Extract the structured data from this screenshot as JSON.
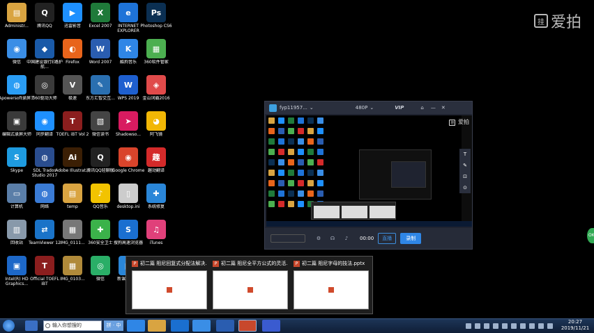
{
  "desktop": {
    "icons": [
      {
        "label": "Administr...",
        "glyph": "▤",
        "color": "#d9a441"
      },
      {
        "label": "腾讯QQ",
        "glyph": "Q",
        "color": "#222222"
      },
      {
        "label": "迅雷影音",
        "glyph": "▶",
        "color": "#1e90ff"
      },
      {
        "label": "Excel 2007",
        "glyph": "X",
        "color": "#1f7a3a"
      },
      {
        "label": "INTERNET EXPLORER",
        "glyph": "e",
        "color": "#1e73d8"
      },
      {
        "label": "Photoshop CS6",
        "glyph": "Ps",
        "color": "#0b2f52"
      },
      {
        "label": "微信",
        "glyph": "◉",
        "color": "#3a8ee6"
      },
      {
        "label": "中国建设银行E路护航...",
        "glyph": "◆",
        "color": "#1a5aa8"
      },
      {
        "label": "Firefox",
        "glyph": "◐",
        "color": "#e8641b"
      },
      {
        "label": "Word 2007",
        "glyph": "W",
        "color": "#2a5db0"
      },
      {
        "label": "酷狗音乐",
        "glyph": "K",
        "color": "#2f86e6"
      },
      {
        "label": "360软件管家",
        "glyph": "▦",
        "color": "#4caf50"
      },
      {
        "label": "Apowersoft录屏王",
        "glyph": "◍",
        "color": "#2a9df4"
      },
      {
        "label": "360驱动大师",
        "glyph": "◎",
        "color": "#3a3a3a"
      },
      {
        "label": "极速",
        "glyph": "V",
        "color": "#555555"
      },
      {
        "label": "东方汇智交互...",
        "glyph": "✎",
        "color": "#2a6fb0"
      },
      {
        "label": "WPS 2019",
        "glyph": "W",
        "color": "#1e5fcf"
      },
      {
        "label": "金山词霸2016",
        "glyph": "◈",
        "color": "#e04a4a"
      },
      {
        "label": "编辑式录屏大师",
        "glyph": "▣",
        "color": "#3a3a3a"
      },
      {
        "label": "同步翻译",
        "glyph": "◉",
        "color": "#1e90ff"
      },
      {
        "label": "TOEFL iBT Vol 2",
        "glyph": "T",
        "color": "#8b1e1e"
      },
      {
        "label": "微信读书",
        "glyph": "▧",
        "color": "#444444"
      },
      {
        "label": "Shadowso...",
        "glyph": "➤",
        "color": "#d81b60"
      },
      {
        "label": "阿飞镜",
        "glyph": "◕",
        "color": "#f2b705"
      },
      {
        "label": "Skype",
        "glyph": "S",
        "color": "#1e9be0"
      },
      {
        "label": "SDL Trados Studio 2017",
        "glyph": "◍",
        "color": "#2a4d8f"
      },
      {
        "label": "Adobe Illustrat...",
        "glyph": "Ai",
        "color": "#3b1f05"
      },
      {
        "label": "腾讯QQ轻聊版",
        "glyph": "Q",
        "color": "#222222"
      },
      {
        "label": "Google Chrome",
        "glyph": "◉",
        "color": "#d9442b"
      },
      {
        "label": "趣动翻译",
        "glyph": "趣",
        "color": "#d42a2a"
      },
      {
        "label": "计算机",
        "glyph": "▭",
        "color": "#5a7ea8"
      },
      {
        "label": "网络",
        "glyph": "◍",
        "color": "#3a7bd5"
      },
      {
        "label": "temp",
        "glyph": "▤",
        "color": "#d9a441"
      },
      {
        "label": "QQ音乐",
        "glyph": "♪",
        "color": "#f2c300"
      },
      {
        "label": "desktop.ini",
        "glyph": "▯",
        "color": "#cccccc"
      },
      {
        "label": "系统修复",
        "glyph": "✚",
        "color": "#2a86d8"
      },
      {
        "label": "回收站",
        "glyph": "▥",
        "color": "#8899aa"
      },
      {
        "label": "TeamViewer 12",
        "glyph": "⇄",
        "color": "#1a73c8"
      },
      {
        "label": "IMG_0111...",
        "glyph": "▦",
        "color": "#777777"
      },
      {
        "label": "360安全卫士",
        "glyph": "✚",
        "color": "#3bb24a"
      },
      {
        "label": "搜狗高速浏览器",
        "glyph": "S",
        "color": "#1a6fd0"
      },
      {
        "label": "iTunes",
        "glyph": "♫",
        "color": "#e0407a"
      },
      {
        "label": "Intel(R) HD Graphics...",
        "glyph": "▣",
        "color": "#1d68c8"
      },
      {
        "label": "Official TOEFL iBT",
        "glyph": "T",
        "color": "#8b1e1e"
      },
      {
        "label": "IMG_0103...",
        "glyph": "▦",
        "color": "#b08a3a"
      },
      {
        "label": "微信",
        "glyph": "◎",
        "color": "#2aae67"
      },
      {
        "label": "新课 口语包",
        "glyph": "▤",
        "color": "#2a86d8"
      }
    ]
  },
  "watermark": {
    "icon": "挂",
    "text": "爱拍"
  },
  "recorder": {
    "user": "fyp11957...",
    "quality": "480P",
    "vip": "VIP",
    "brand": "爱拍",
    "time": "00:00",
    "live_label": "直播",
    "record_label": "录制",
    "side_icons": [
      "T",
      "✎",
      "⊡",
      "⊙"
    ]
  },
  "thumbnails": [
    {
      "title": "初二篇  阻尼回复式分配法解决...",
      "x_label": "x"
    },
    {
      "title": "初二篇  阻尼全平方公式的灵活...",
      "x_label": "x"
    },
    {
      "title": "初二篇  阻尼字母的技法.pptx",
      "x_label": "x"
    }
  ],
  "taskbar": {
    "search_text": "输入你想搜的",
    "ime_label": "拼 · 中",
    "clock_time": "20:27",
    "clock_date": "2019/11/21",
    "edge_badge": "OK"
  }
}
